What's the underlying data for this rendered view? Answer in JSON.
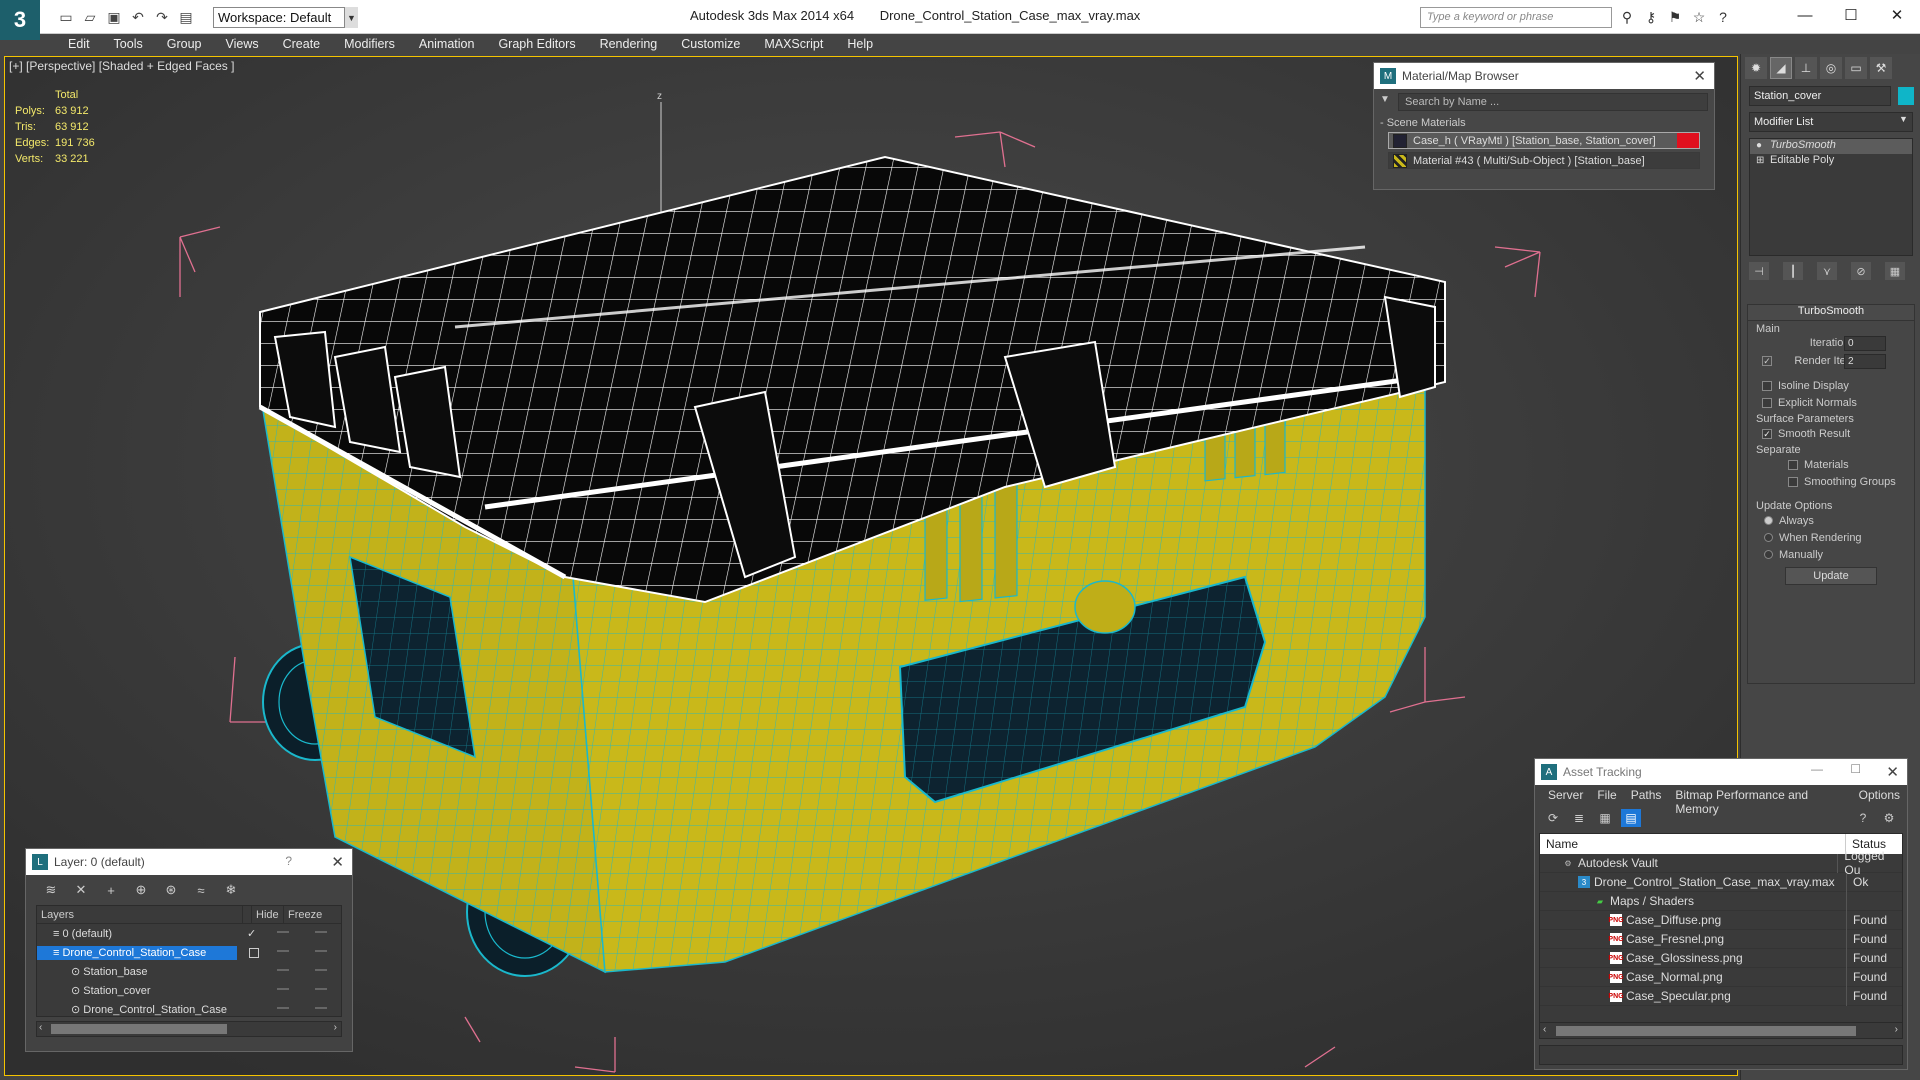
{
  "title_bar": {
    "app_name": "Autodesk 3ds Max  2014 x64",
    "file_name": "Drone_Control_Station_Case_max_vray.max",
    "workspace": "Workspace: Default",
    "search_placeholder": "Type a keyword or phrase"
  },
  "menu": [
    "Edit",
    "Tools",
    "Group",
    "Views",
    "Create",
    "Modifiers",
    "Animation",
    "Graph Editors",
    "Rendering",
    "Customize",
    "MAXScript",
    "Help"
  ],
  "viewport": {
    "label": "[+] [Perspective] [Shaded + Edged Faces ]",
    "stats": {
      "header": "Total",
      "rows": [
        {
          "label": "Polys:",
          "value": "63 912"
        },
        {
          "label": "Tris:",
          "value": "63 912"
        },
        {
          "label": "Edges:",
          "value": "191 736"
        },
        {
          "label": "Verts:",
          "value": "33 221"
        }
      ]
    },
    "axis_label": "z"
  },
  "material_browser": {
    "title": "Material/Map Browser",
    "search_placeholder": "Search by Name ...",
    "section": "- Scene Materials",
    "materials": [
      {
        "label": "Case_h  ( VRayMtl ) [Station_base, Station_cover]",
        "selected": true
      },
      {
        "label": "Material #43  ( Multi/Sub-Object ) [Station_base]",
        "selected": false
      }
    ]
  },
  "command_panel": {
    "object_name": "Station_cover",
    "object_color": "#0fb5c8",
    "modifier_list": "Modifier List",
    "stack": [
      "TurboSmooth",
      "Editable Poly"
    ],
    "rollout": {
      "title": "TurboSmooth",
      "main_label": "Main",
      "iterations_label": "Iterations:",
      "iterations_value": "0",
      "render_iters_label": "Render Iters:",
      "render_iters_value": "2",
      "isoline": "Isoline Display",
      "explicit": "Explicit Normals",
      "surface_label": "Surface Parameters",
      "smooth_result": "Smooth Result",
      "separate_label": "Separate",
      "materials": "Materials",
      "smoothing_groups": "Smoothing Groups",
      "update_options_label": "Update Options",
      "always": "Always",
      "when_rendering": "When Rendering",
      "manually": "Manually",
      "update_button": "Update"
    }
  },
  "layer_panel": {
    "title": "Layer: 0 (default)",
    "help": "?",
    "columns": {
      "layers": "Layers",
      "hide": "Hide",
      "freeze": "Freeze"
    },
    "rows": [
      {
        "name": "0 (default)",
        "indent": 0,
        "selected": false
      },
      {
        "name": "Drone_Control_Station_Case",
        "indent": 0,
        "selected": true
      },
      {
        "name": "Station_base",
        "indent": 1,
        "selected": false
      },
      {
        "name": "Station_cover",
        "indent": 1,
        "selected": false
      },
      {
        "name": "Drone_Control_Station_Case",
        "indent": 1,
        "selected": false
      }
    ]
  },
  "asset_tracking": {
    "title": "Asset Tracking",
    "menu": [
      "Server",
      "File",
      "Paths",
      "Bitmap Performance and Memory",
      "Options"
    ],
    "columns": {
      "name": "Name",
      "status": "Status"
    },
    "rows": [
      {
        "name": "Autodesk Vault",
        "status": "Logged Ou",
        "indent": 1
      },
      {
        "name": "Drone_Control_Station_Case_max_vray.max",
        "status": "Ok",
        "indent": 2
      },
      {
        "name": "Maps / Shaders",
        "status": "",
        "indent": 3
      },
      {
        "name": "Case_Diffuse.png",
        "status": "Found",
        "indent": 4
      },
      {
        "name": "Case_Fresnel.png",
        "status": "Found",
        "indent": 4
      },
      {
        "name": "Case_Glossiness.png",
        "status": "Found",
        "indent": 4
      },
      {
        "name": "Case_Normal.png",
        "status": "Found",
        "indent": 4
      },
      {
        "name": "Case_Specular.png",
        "status": "Found",
        "indent": 4
      }
    ]
  },
  "colors": {
    "case_body": "#c9b81a",
    "wireframe": "#ffffff",
    "edges": "#1ab8cc",
    "selection": "#1e78d8",
    "viewport_border": "#f5c400"
  }
}
